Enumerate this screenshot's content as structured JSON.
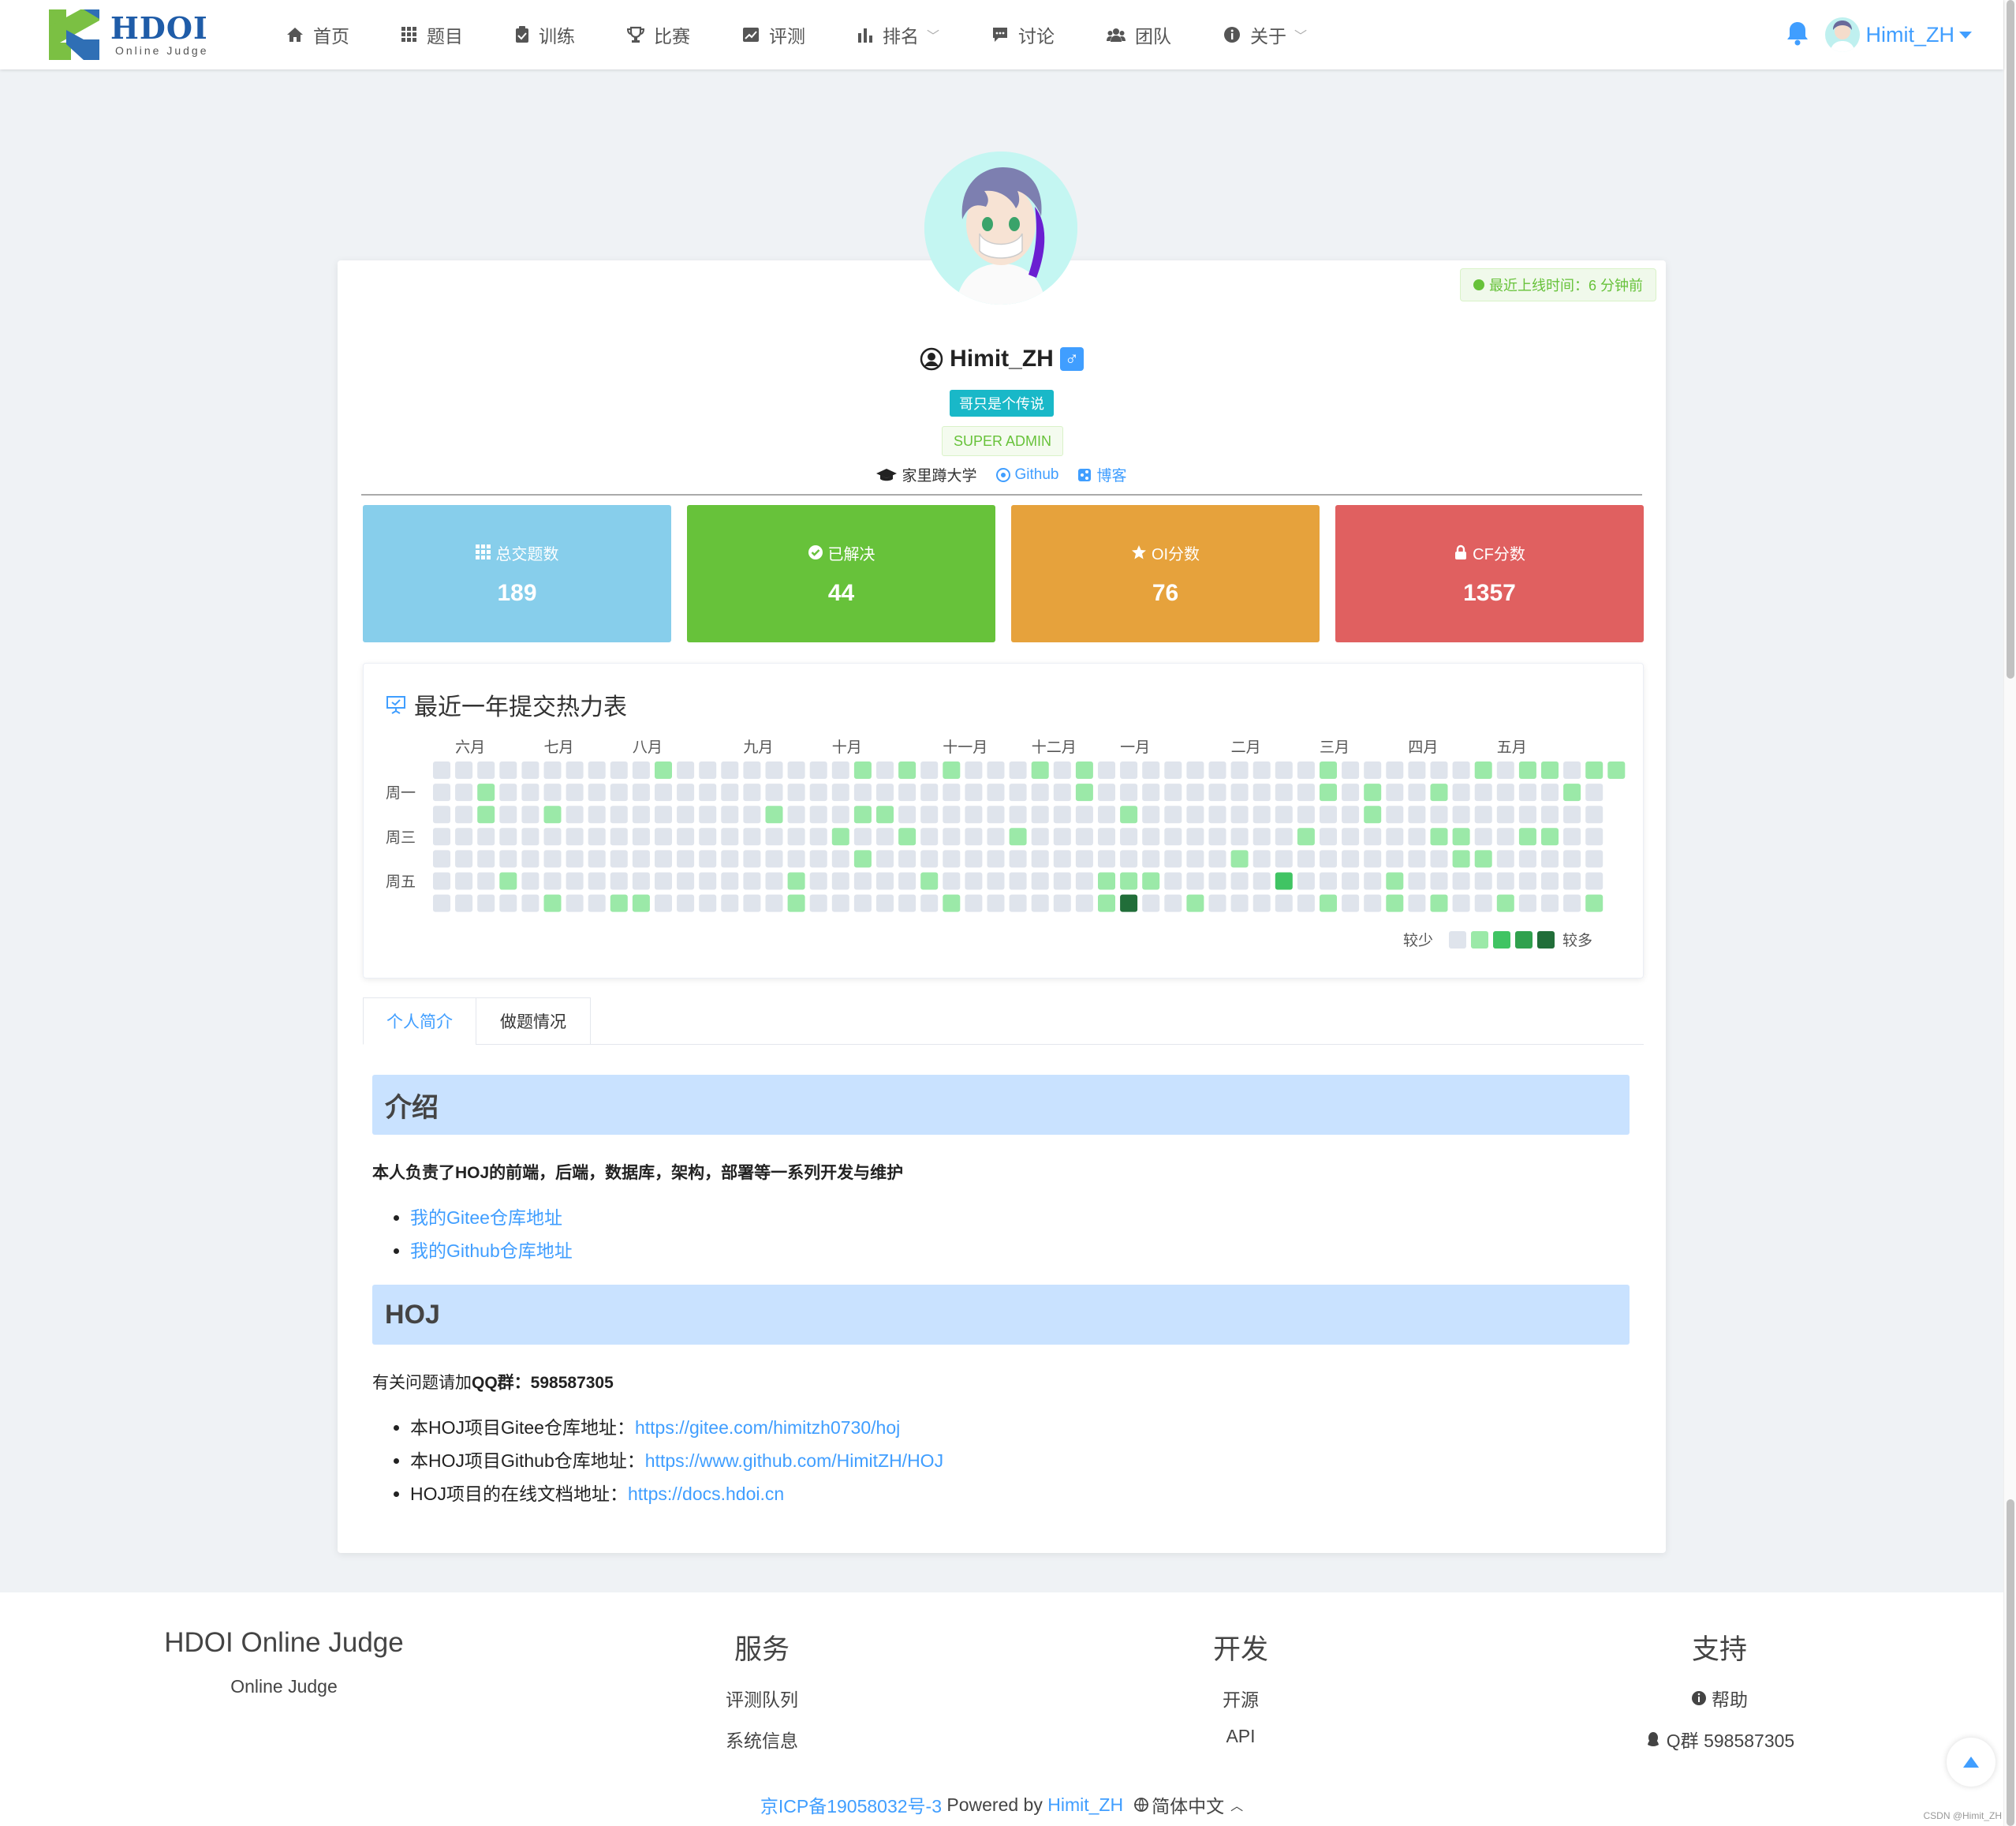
{
  "nav": {
    "logo_title": "HDOI",
    "logo_sub": "Online Judge",
    "items": [
      {
        "label": "首页",
        "icon": "home-icon"
      },
      {
        "label": "题目",
        "icon": "grid-icon"
      },
      {
        "label": "训练",
        "icon": "clipboard-icon"
      },
      {
        "label": "比赛",
        "icon": "trophy-icon"
      },
      {
        "label": "评测",
        "icon": "chart-line-icon"
      },
      {
        "label": "排名",
        "icon": "bar-chart-icon",
        "dropdown": true
      },
      {
        "label": "讨论",
        "icon": "comment-icon"
      },
      {
        "label": "团队",
        "icon": "users-icon"
      },
      {
        "label": "关于",
        "icon": "info-icon",
        "dropdown": true
      }
    ],
    "username": "Himit_ZH"
  },
  "profile": {
    "online": "最近上线时间：6 分钟前",
    "username": "Himit_ZH",
    "gender": "♂",
    "title_tag": "哥只是个传说",
    "role_tag": "SUPER ADMIN",
    "school": "家里蹲大学",
    "github": "Github",
    "blog": "博客"
  },
  "stats": [
    {
      "label": "总交题数",
      "value": "189",
      "color": "#87ceeb",
      "icon": "grid-icon"
    },
    {
      "label": "已解决",
      "value": "44",
      "color": "#67c23a",
      "icon": "check-circle-icon"
    },
    {
      "label": "OI分数",
      "value": "76",
      "color": "#e6a23c",
      "icon": "star-icon"
    },
    {
      "label": "CF分数",
      "value": "1357",
      "color": "#e06060",
      "icon": "lock-icon"
    }
  ],
  "heatmap": {
    "title": "最近一年提交热力表",
    "months": [
      "六月",
      "七月",
      "八月",
      "九月",
      "十月",
      "十一月",
      "十二月",
      "一月",
      "二月",
      "三月",
      "四月",
      "五月"
    ],
    "month_weeks": [
      1,
      5,
      9,
      14,
      18,
      23,
      27,
      31,
      36,
      40,
      44,
      48
    ],
    "weekdays": [
      "周一",
      "周三",
      "周五"
    ],
    "legend_less": "较少",
    "legend_more": "较多",
    "levels": [
      "#dfe4ec",
      "#9be9a8",
      "#40c463",
      "#30a14e",
      "#216e39"
    ],
    "active": [
      [
        2,
        1
      ],
      [
        2,
        2
      ],
      [
        3,
        5
      ],
      [
        5,
        2
      ],
      [
        5,
        6
      ],
      [
        8,
        6
      ],
      [
        9,
        6
      ],
      [
        10,
        0
      ],
      [
        15,
        2
      ],
      [
        16,
        5
      ],
      [
        16,
        6
      ],
      [
        18,
        3
      ],
      [
        19,
        0
      ],
      [
        19,
        2
      ],
      [
        19,
        4
      ],
      [
        20,
        2
      ],
      [
        21,
        0
      ],
      [
        21,
        3
      ],
      [
        22,
        5
      ],
      [
        23,
        6
      ],
      [
        23,
        0
      ],
      [
        26,
        3
      ],
      [
        27,
        0
      ],
      [
        29,
        0
      ],
      [
        29,
        1
      ],
      [
        30,
        5
      ],
      [
        30,
        6
      ],
      [
        31,
        2
      ],
      [
        31,
        5
      ],
      [
        31,
        6,
        4
      ],
      [
        32,
        5
      ],
      [
        34,
        6
      ],
      [
        36,
        4
      ],
      [
        38,
        5,
        2
      ],
      [
        39,
        3
      ],
      [
        40,
        0
      ],
      [
        40,
        1
      ],
      [
        40,
        6
      ],
      [
        42,
        1
      ],
      [
        42,
        2
      ],
      [
        43,
        5
      ],
      [
        43,
        6
      ],
      [
        45,
        1
      ],
      [
        45,
        3
      ],
      [
        45,
        6
      ],
      [
        46,
        3
      ],
      [
        46,
        4
      ],
      [
        47,
        0
      ],
      [
        47,
        4
      ],
      [
        48,
        6
      ],
      [
        49,
        0
      ],
      [
        49,
        3
      ],
      [
        50,
        0
      ],
      [
        50,
        3
      ],
      [
        51,
        1
      ],
      [
        52,
        0
      ],
      [
        52,
        6
      ],
      [
        53,
        0
      ]
    ]
  },
  "tabs": [
    "个人简介",
    "做题情况"
  ],
  "intro": {
    "h1": "介绍",
    "p1": "本人负责了HOJ的前端，后端，数据库，架构，部署等一系列开发与维护",
    "list1": [
      "我的Gitee仓库地址",
      "我的Github仓库地址"
    ],
    "h2": "HOJ",
    "p2_prefix": "有关问题请加",
    "p2_bold": "QQ群：598587305",
    "list2": [
      {
        "prefix": "本HOJ项目Gitee仓库地址：",
        "link": "https://gitee.com/himitzh0730/hoj"
      },
      {
        "prefix": "本HOJ项目Github仓库地址：",
        "link": "https://www.github.com/HimitZH/HOJ"
      },
      {
        "prefix": "HOJ项目的在线文档地址：",
        "link": "https://docs.hdoi.cn"
      }
    ]
  },
  "footer": {
    "col1_title": "HDOI Online Judge",
    "col1_item": "Online Judge",
    "col2_title": "服务",
    "col2_items": [
      "评测队列",
      "系统信息"
    ],
    "col3_title": "开发",
    "col3_items": [
      "开源",
      "API"
    ],
    "col4_title": "支持",
    "col4_items": [
      "帮助",
      "Q群 598587305"
    ],
    "icp": "京ICP备19058032号-3",
    "powered": " Powered by ",
    "author": "Himit_ZH",
    "lang": "简体中文",
    "watermark": "CSDN @Himit_ZH"
  }
}
